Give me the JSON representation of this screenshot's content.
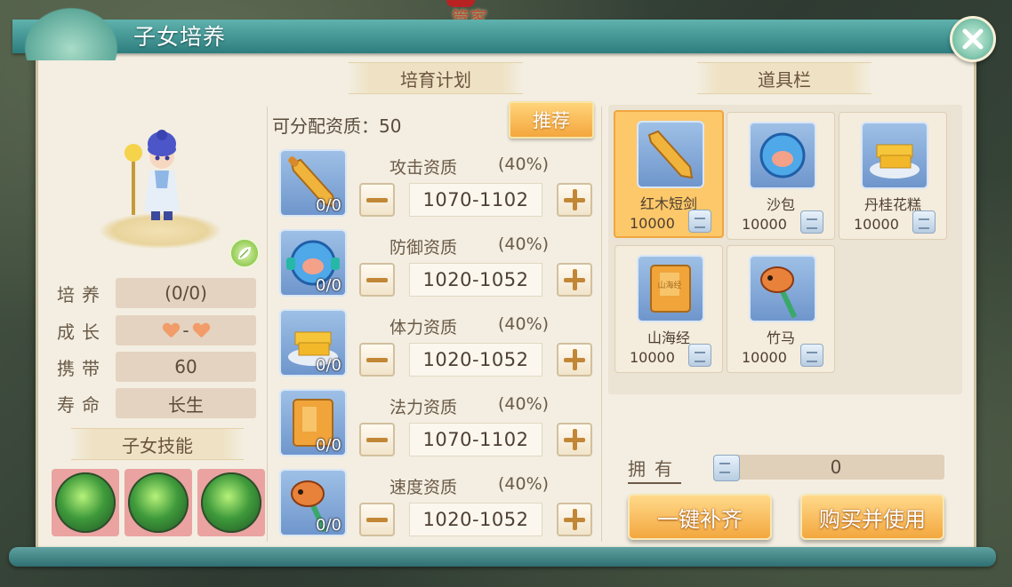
{
  "background": {
    "npc_label": "管家"
  },
  "window": {
    "title": "子女培养"
  },
  "left": {
    "stats": [
      {
        "label": "培养",
        "value": "(0/0)"
      },
      {
        "label": "成长",
        "value": "-"
      },
      {
        "label": "携带",
        "value": "60"
      },
      {
        "label": "寿命",
        "value": "长生"
      }
    ],
    "skills_title": "子女技能"
  },
  "plan": {
    "title": "培育计划",
    "free_points_label": "可分配资质：50",
    "recommend_label": "推荐",
    "attributes": [
      {
        "name": "攻击资质",
        "percent": "(40%)",
        "range": "1070-1102",
        "count": "0/0",
        "icon": "sword-icon"
      },
      {
        "name": "防御资质",
        "percent": "(40%)",
        "range": "1020-1052",
        "count": "0/0",
        "icon": "sandbag-icon"
      },
      {
        "name": "体力资质",
        "percent": "(40%)",
        "range": "1020-1052",
        "count": "0/0",
        "icon": "cake-icon"
      },
      {
        "name": "法力资质",
        "percent": "(40%)",
        "range": "1070-1102",
        "count": "0/0",
        "icon": "book-icon"
      },
      {
        "name": "速度资质",
        "percent": "(40%)",
        "range": "1020-1052",
        "count": "0/0",
        "icon": "hobby-horse-icon"
      }
    ]
  },
  "bag": {
    "title": "道具栏",
    "items": [
      {
        "name": "红木短剑",
        "qty": "10000",
        "icon": "sword-icon",
        "selected": true
      },
      {
        "name": "沙包",
        "qty": "10000",
        "icon": "sandbag-icon"
      },
      {
        "name": "丹桂花糕",
        "qty": "10000",
        "icon": "cake-icon"
      },
      {
        "name": "山海经",
        "qty": "10000",
        "icon": "book-icon"
      },
      {
        "name": "竹马",
        "qty": "10000",
        "icon": "hobby-horse-icon"
      }
    ],
    "book_cover_text": "山海经",
    "owned_label": "拥有",
    "owned_value": "0",
    "fill_button": "一键补齐",
    "buy_button": "购买并使用"
  },
  "colors": {
    "accent_gold": "#f4a63d",
    "title_teal": "#2d7d7e",
    "panel": "#f3eee1"
  }
}
